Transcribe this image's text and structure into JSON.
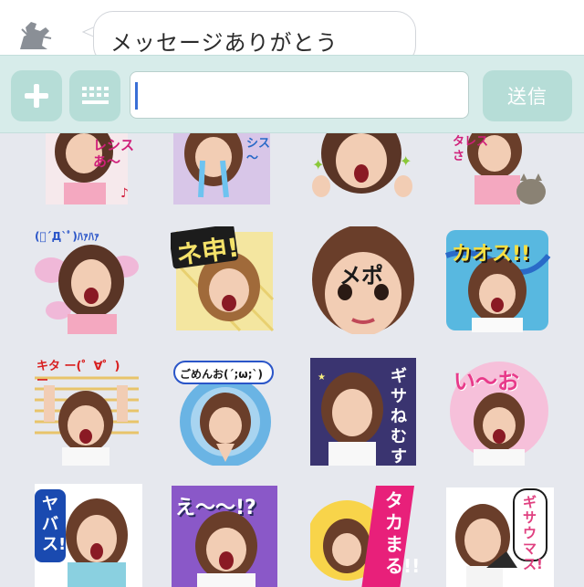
{
  "chat": {
    "message": "メッセージありがとう"
  },
  "toolbar": {
    "send_label": "送信",
    "input_value": ""
  },
  "stickers": [
    {
      "caption": "レシス あ〜"
    },
    {
      "caption": "シス 〜"
    },
    {
      "caption": ""
    },
    {
      "caption": "タレス さ"
    },
    {
      "caption": "(ﾟ´Д`ﾟ)ﾊｧﾊｧ"
    },
    {
      "caption": "ネ申!"
    },
    {
      "caption": "メポ"
    },
    {
      "caption": "カオス!!"
    },
    {
      "caption": "キタ ー(゜∀゜)ー"
    },
    {
      "caption": "ごめんお(´;ω;`)"
    },
    {
      "caption": "ギサねむす"
    },
    {
      "caption": "い〜お"
    },
    {
      "caption": "ヤバス!"
    },
    {
      "caption": "え〜〜!?"
    },
    {
      "caption": "タカまる!!"
    },
    {
      "caption": "ギサウマス!"
    }
  ],
  "colors": {
    "toolbar": "#d7ecea",
    "button": "#b6ddd7",
    "caret": "#3a6fd6",
    "grid_bg": "#e6e8ee"
  }
}
